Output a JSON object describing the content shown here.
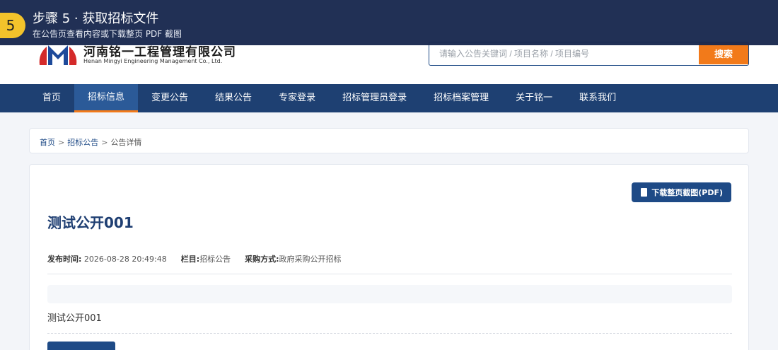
{
  "overlay": {
    "step_number": "5",
    "title": "步骤 5 · 获取招标文件",
    "subtitle": "在公告页查看内容或下载整页 PDF 截图"
  },
  "header": {
    "company_cn": "河南铭一工程管理有限公司",
    "company_en": "Henan Mingyi Engineering Management Co., Ltd.",
    "search_placeholder": "请输入公告关键词 / 项目名称 / 项目编号",
    "search_button": "搜索"
  },
  "nav": {
    "items": [
      "首页",
      "招标信息",
      "变更公告",
      "结果公告",
      "专家登录",
      "招标管理员登录",
      "招标档案管理",
      "关于铭一",
      "联系我们"
    ],
    "active": "招标信息"
  },
  "breadcrumb": {
    "home": "首页",
    "section": "招标公告",
    "current": "公告详情",
    "separator": ">"
  },
  "notice": {
    "download_button": "下载整页截图(PDF)",
    "title": "测试公开001",
    "published_label": "发布时间:",
    "published_value": "2026-08-28 20:49:48",
    "column_label": "栏目:",
    "column_value": "招标公告",
    "method_label": "采购方式:",
    "method_value": "政府采购公开招标",
    "body": "测试公开001"
  },
  "colors": {
    "nav_bg": "#1e4072",
    "accent_orange": "#f27a1a",
    "primary_blue": "#1e4a86",
    "overlay_bg": "#18284e",
    "badge_yellow": "#f3c32b"
  }
}
